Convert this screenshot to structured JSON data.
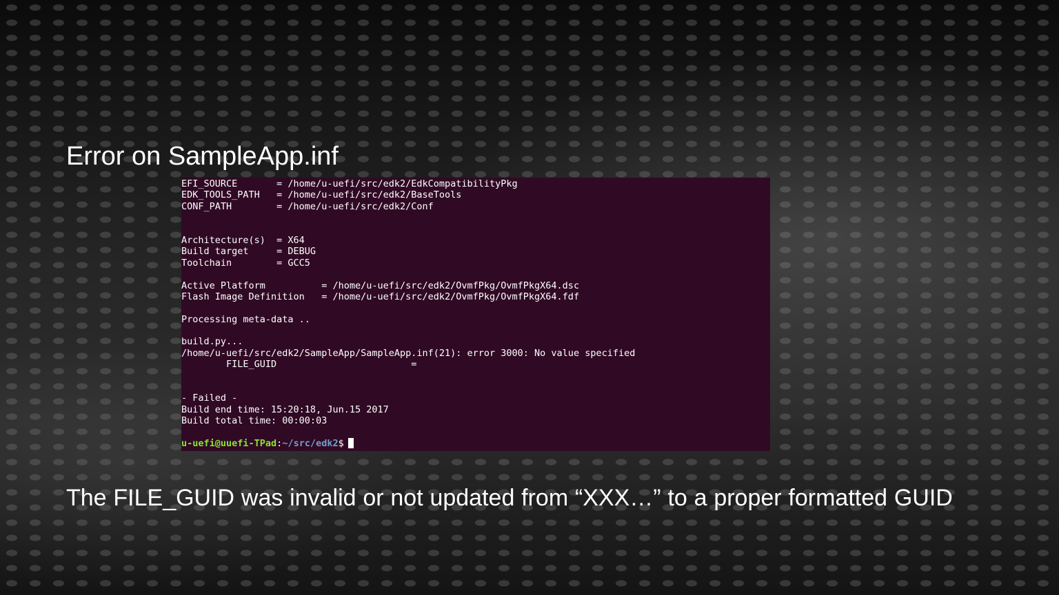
{
  "slide": {
    "title": "Error on SampleApp.inf",
    "caption_words": [
      "The",
      "FILE_GUID",
      "was",
      "invalid",
      "or",
      "not",
      "updated",
      "from",
      "“XXX…”",
      "to",
      "a",
      "proper",
      "formatted",
      "GUID"
    ]
  },
  "terminal": {
    "background": "#300a24",
    "lines": [
      "EFI_SOURCE       = /home/u-uefi/src/edk2/EdkCompatibilityPkg",
      "EDK_TOOLS_PATH   = /home/u-uefi/src/edk2/BaseTools",
      "CONF_PATH        = /home/u-uefi/src/edk2/Conf",
      "",
      "",
      "Architecture(s)  = X64",
      "Build target     = DEBUG",
      "Toolchain        = GCC5",
      "",
      "Active Platform          = /home/u-uefi/src/edk2/OvmfPkg/OvmfPkgX64.dsc",
      "Flash Image Definition   = /home/u-uefi/src/edk2/OvmfPkg/OvmfPkgX64.fdf",
      "",
      "Processing meta-data ..",
      "",
      "build.py...",
      "/home/u-uefi/src/edk2/SampleApp/SampleApp.inf(21): error 3000: No value specified",
      "        FILE_GUID                        =",
      "",
      "",
      "- Failed -",
      "Build end time: 15:20:18, Jun.15 2017",
      "Build total time: 00:00:03",
      ""
    ],
    "prompt": {
      "user_host": "u-uefi@uuefi-TPad",
      "separator": ":",
      "path": "~/src/edk2",
      "symbol": "$",
      "user_color": "#8ae234",
      "path_color": "#729fcf"
    }
  }
}
